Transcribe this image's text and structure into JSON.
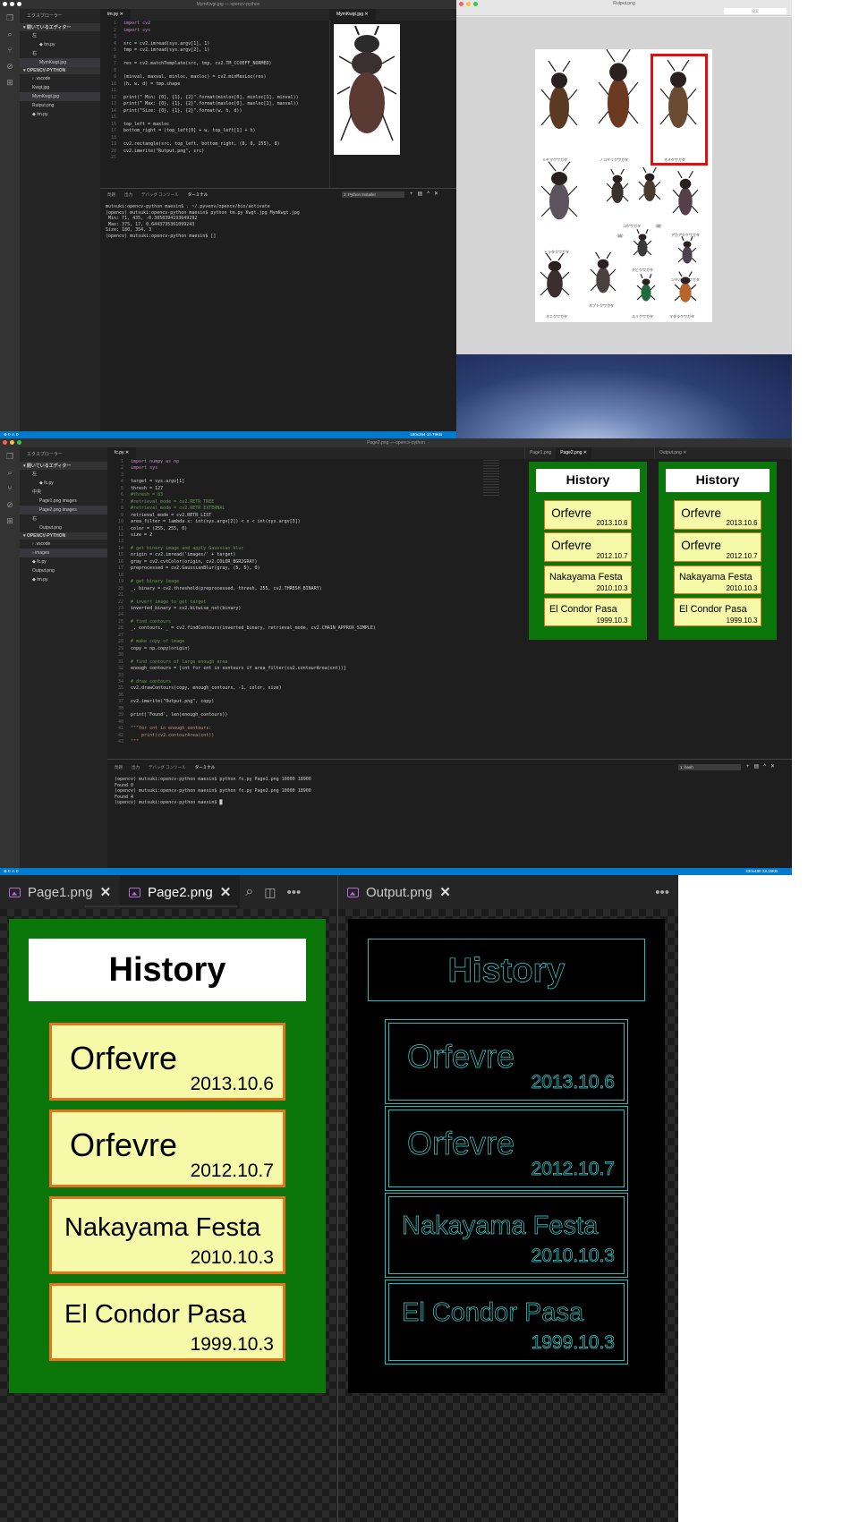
{
  "win1": {
    "title": "MymKwgt.jpg — opencv-python",
    "explorer_header": "エクスプローラー",
    "open_editors": "▾ 開いているエディター",
    "group_left": "左",
    "group_left_file": "◆ tm.py",
    "group_right": "右",
    "group_right_file": "MymKwgt.jpg",
    "folder": "▾ OPENCV-PYTHON",
    "files": [
      "› .vscode",
      "Kwgt.jpg",
      "MymKwgt.jpg",
      "Rutput.png",
      "◆ tm.py"
    ],
    "tab_code": "tm.py",
    "tab_image": "MymKwgt.jpg",
    "code_lines": [
      "import cv2",
      "import sys",
      "",
      "src = cv2.imread(sys.argv[1], 1)",
      "tmp = cv2.imread(sys.argv[2], 1)",
      "",
      "res = cv2.matchTemplate(src, tmp, cv2.TM_CCOEFF_NORMED)",
      "",
      "(minval, maxval, minloc, maxloc) = cv2.minMaxLoc(res)",
      "(h, w, d) = tmp.shape",
      "",
      "print(\" Min: {0}, {1}, {2}\".format(minloc[0], minloc[1], minval))",
      "print(\" Max: {0}, {1}, {2}\".format(maxloc[0], maxloc[1], maxval))",
      "print(\"Size: {0}, {1}, {2}\".format(w, h, d))",
      "",
      "top_left = maxloc",
      "bottom_right = (top_left[0] + w, top_left[1] + h)",
      "",
      "cv2.rectangle(src, top_left, bottom_right, (0, 0, 255), 8)",
      "cv2.imwrite(\"Rutput.png\", src)",
      ""
    ],
    "term_tabs": [
      "問題",
      "出力",
      "デバッグ コンソール",
      "ターミナル"
    ],
    "term_select": "2: Python Installer",
    "term_lines": [
      "mutsuki:opencv-python maesin$ . ~/.pyvenv/opencv/bin/activate",
      "(opencv) mutsuki:opencv-python maesin$ python tm.py Kwgt.jpg MymKwgt.jpg",
      " Min: 71, 435, -0.3058394193649292",
      " Max: 375, 17, 0.6443735361099243",
      "Size: 180, 354, 3",
      "(opencv) mutsuki:opencv-python maesin$ []"
    ],
    "status_left": "⊗ 0 ⚠ 0",
    "status_right": "180x354 10.79KB"
  },
  "preview": {
    "title": "Rutput.png",
    "search_placeholder": "検索",
    "beetle_labels": [
      "ミヤマクワガタ",
      "ノコギリクワガタ",
      "オオクワガタ",
      "コクワガタ",
      "（雌）",
      "（雌）",
      "アカアシクワガタ",
      "ヒラタクワガタ",
      "チビクワガタ",
      "ツヤハダクワガタ",
      "オニクワガタ",
      "ネブトクワガタ",
      "ルリクワガタ",
      "マダラクワガタ"
    ]
  },
  "win2": {
    "title": "Page2.png — opencv-python",
    "explorer_header": "エクスプローラー",
    "open_editors": "▾ 開いているエディター",
    "group_left": "左",
    "group_left_file": "◆ fc.py",
    "group_mid": "中央",
    "group_mid_files": [
      "Page1.png  images",
      "Page2.png  images"
    ],
    "group_right": "右",
    "group_right_file": "Output.png",
    "folder": "▾ OPENCV-PYTHON",
    "files": [
      "› .vscode",
      "› images",
      "◆ fc.py",
      "Output.png",
      "◆ tm.py"
    ],
    "tab_code": "fc.py",
    "tab_page1": "Page1.png",
    "tab_page2": "Page2.png",
    "tab_output": "Output.png",
    "code_lines": [
      "import numpy as np",
      "import sys",
      "",
      "target = sys.argv[1]",
      "thresh = 127",
      "#thresh = 83",
      "#retrieval_mode = cv2.RETR_TREE",
      "#retrieval_mode = cv2.RETR_EXTERNAL",
      "retrieval_mode = cv2.RETR_LIST",
      "area_filter = lambda x: int(sys.argv[2]) < x < int(sys.argv[3])",
      "color = (255, 255, 0)",
      "size = 2",
      "",
      "# get binary image and apply Gaussian blur",
      "origin = cv2.imread('images/' + target)",
      "gray = cv2.cvtColor(origin, cv2.COLOR_BGR2GRAY)",
      "preprocessed = cv2.GaussianBlur(gray, (5, 5), 0)",
      "",
      "# get binary image",
      "_, binary = cv2.threshold(preprocessed, thresh, 255, cv2.THRESH_BINARY)",
      "",
      "# invert image to get target",
      "inverted_binary = cv2.bitwise_not(binary)",
      "",
      "# find contours",
      "_, contours, _ = cv2.findContours(inverted_binary, retrieval_mode, cv2.CHAIN_APPROX_SIMPLE)",
      "",
      "# make copy of image",
      "copy = np.copy(origin)",
      "",
      "# find contours of large enough area",
      "enough_contours = [cnt for cnt in contours if area_filter(cv2.contourArea(cnt))]",
      "",
      "# draw contours",
      "cv2.drawContours(copy, enough_contours, -1, color, size)",
      "",
      "cv2.imwrite(\"Output.png\", copy)",
      "",
      "print('Found', len(enough_contours))",
      "",
      "\"\"\"for cnt in enough_contours:",
      "    print(cv2.contourArea(cnt))",
      "\"\"\""
    ],
    "term_tabs": [
      "問題",
      "出力",
      "デバッグ コンソール",
      "ターミナル"
    ],
    "term_select": "1: bash",
    "term_lines": [
      "(opencv) mutsuki:opencv-python maesin$ python fc.py Page1.png 10000 18900",
      "Found 0",
      "(opencv) mutsuki:opencv-python maesin$ python fc.py Page2.png 10000 18900",
      "Found 4",
      "(opencv) mutsuki:opencv-python maesin$ █"
    ],
    "status_left": "⊗ 0 ⚠ 0",
    "status_right": "330x480 23.15KB"
  },
  "history": {
    "title": "History",
    "cards": [
      {
        "name": "Orfevre",
        "date": "2013.10.6"
      },
      {
        "name": "Orfevre",
        "date": "2012.10.7"
      },
      {
        "name": "Nakayama Festa",
        "date": "2010.10.3"
      },
      {
        "name": "El Condor Pasa",
        "date": "1999.10.3"
      }
    ]
  },
  "zoom": {
    "tab_page1": "Page1.png",
    "tab_page2": "Page2.png",
    "tab_output": "Output.png",
    "close": "✕",
    "more": "•••"
  }
}
